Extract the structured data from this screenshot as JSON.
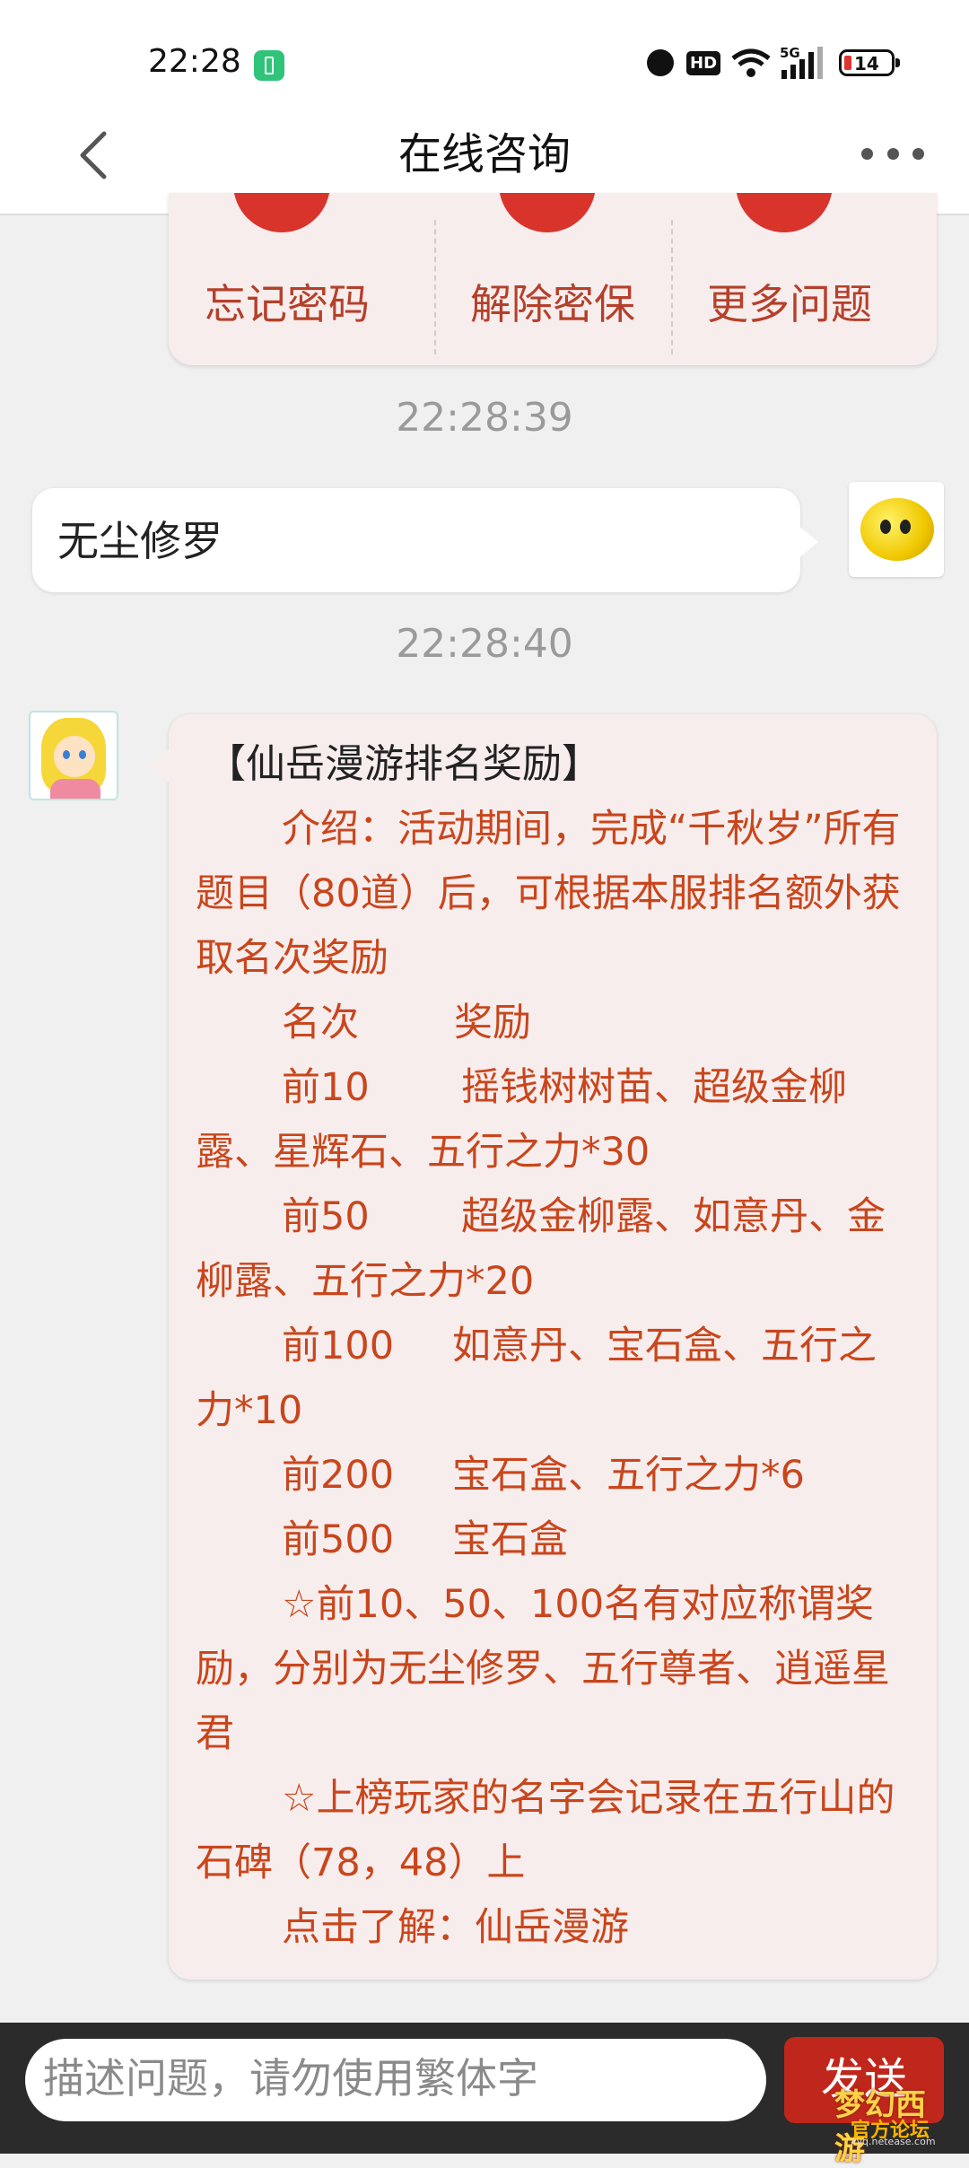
{
  "status_bar": {
    "time": "22:28",
    "battery_level": "14",
    "network": "5G",
    "hd_label": "HD"
  },
  "header": {
    "title": "在线咨询"
  },
  "quick_actions": [
    "忘记密码",
    "解除密保",
    "更多问题"
  ],
  "messages": {
    "time1": "22:28:39",
    "user_text": "无尘修罗",
    "time2": "22:28:40",
    "agent": {
      "title": "【仙岳漫游排名奖励】",
      "intro": "介绍：活动期间，完成“千秋岁”所有题目（80道）后，可根据本服排名额外获取名次奖励",
      "table_header": {
        "rank": "名次",
        "reward": "奖励"
      },
      "rows": [
        {
          "rank": "前10",
          "reward": "摇钱树树苗、超级金柳露、星辉石、五行之力*30"
        },
        {
          "rank": "前50",
          "reward": "超级金柳露、如意丹、金柳露、五行之力*20"
        },
        {
          "rank": "前100",
          "reward": "如意丹、宝石盒、五行之力*10"
        },
        {
          "rank": "前200",
          "reward": "宝石盒、五行之力*6"
        },
        {
          "rank": "前500",
          "reward": "宝石盒"
        }
      ],
      "note1": "☆前10、50、100名有对应称谓奖励，分别为无尘修罗、五行尊者、逍遥星君",
      "note2": "☆上榜玩家的名字会记录在五行山的石碑（78，48）上",
      "link_label": "点击了解：",
      "link_text": "仙岳漫游"
    }
  },
  "input": {
    "placeholder": "描述问题，请勿使用繁体字",
    "send_label": "发送"
  },
  "watermark": {
    "logo_text": "梦幻西游",
    "forum_text": "官方论坛",
    "url": "xyq.netease.com"
  },
  "colors": {
    "accent_red": "#d8342c",
    "message_text": "#c9461c",
    "bubble_bg": "#f7eded",
    "send_button": "#c0271c"
  }
}
